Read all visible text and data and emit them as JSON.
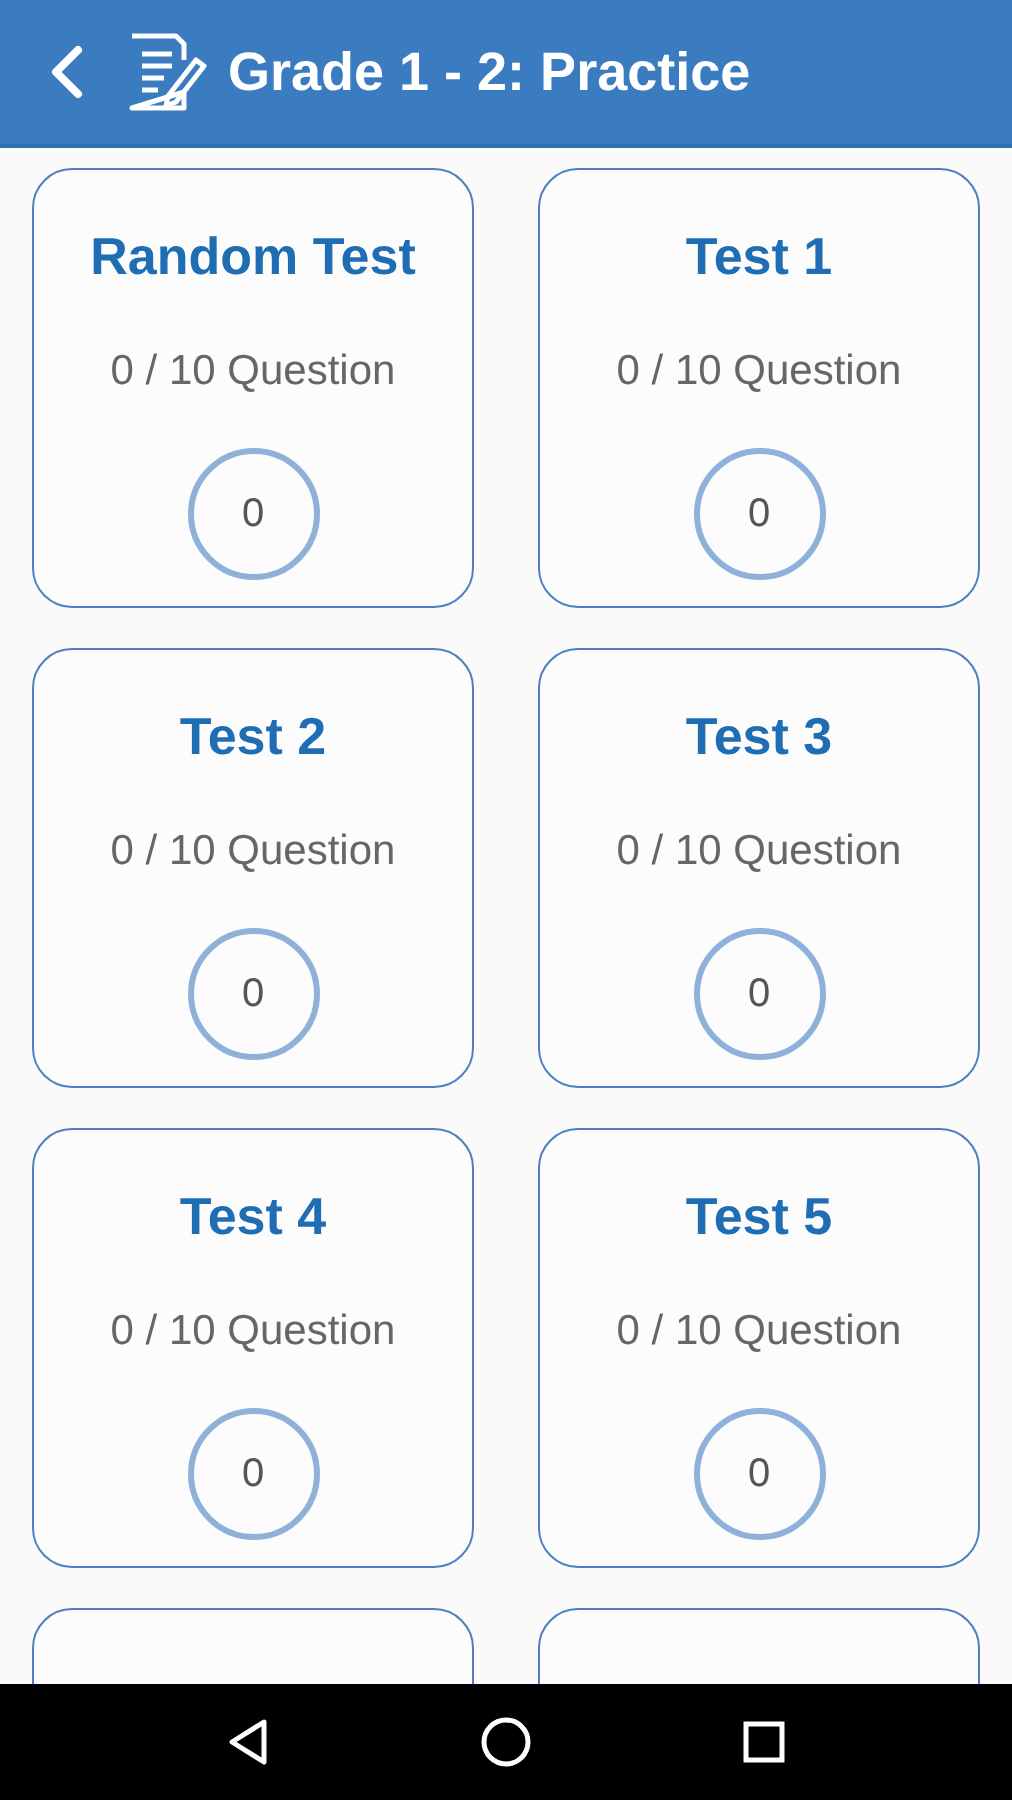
{
  "header": {
    "title": "Grade 1 - 2: Practice"
  },
  "tests": [
    {
      "kind": "full",
      "title": "Random Test",
      "progress": "0 / 10 Question",
      "score": "0"
    },
    {
      "kind": "full",
      "title": "Test 1",
      "progress": "0 / 10 Question",
      "score": "0"
    },
    {
      "kind": "full",
      "title": "Test 2",
      "progress": "0 / 10 Question",
      "score": "0"
    },
    {
      "kind": "full",
      "title": "Test 3",
      "progress": "0 / 10 Question",
      "score": "0"
    },
    {
      "kind": "full",
      "title": "Test 4",
      "progress": "0 / 10 Question",
      "score": "0"
    },
    {
      "kind": "full",
      "title": "Test 5",
      "progress": "0 / 10 Question",
      "score": "0"
    },
    {
      "kind": "cut"
    },
    {
      "kind": "cut"
    }
  ]
}
